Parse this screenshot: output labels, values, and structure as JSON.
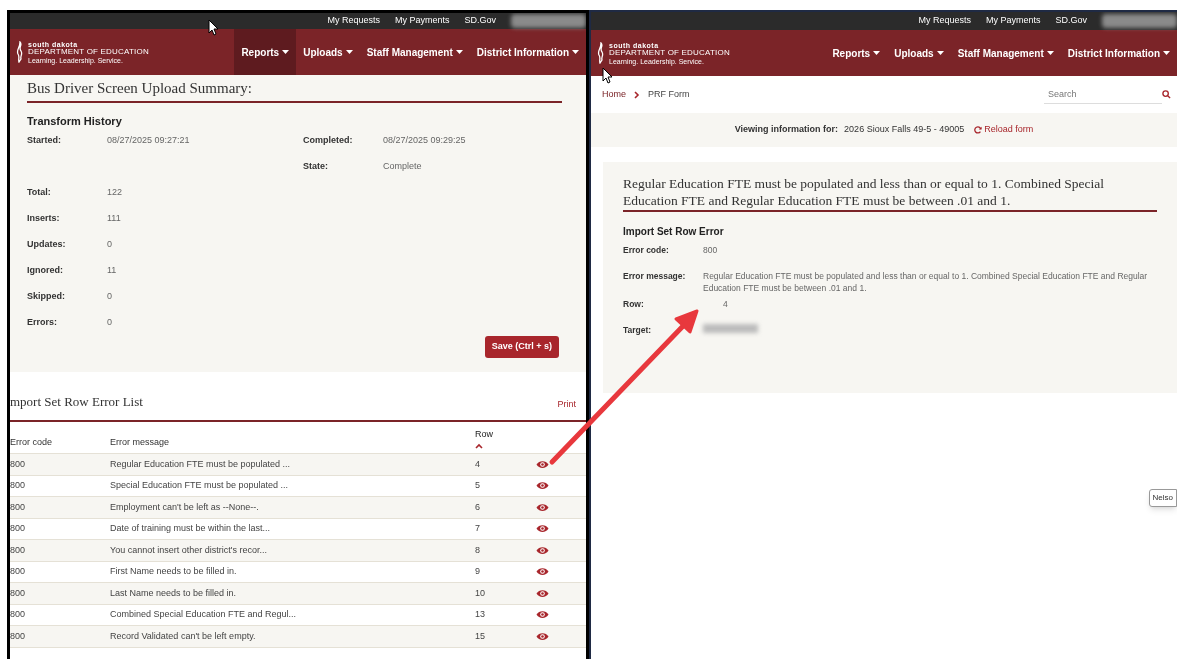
{
  "left": {
    "top_links": [
      "My Requests",
      "My Payments",
      "SD.Gov"
    ],
    "logo": {
      "line1": "south dakota",
      "line2": "DEPARTMENT OF EDUCATION",
      "tagline": "Learning. Leadership. Service."
    },
    "nav": [
      {
        "label": "Reports",
        "selected": true
      },
      {
        "label": "Uploads",
        "selected": false
      },
      {
        "label": "Staff Management",
        "selected": false
      },
      {
        "label": "District Information",
        "selected": false
      }
    ],
    "title": "Bus Driver Screen Upload Summary:",
    "history": {
      "title": "Transform History",
      "column_1": [
        {
          "label": "Started:",
          "value": "08/27/2025 09:27:21"
        }
      ],
      "column_2": [
        {
          "label": "Completed:",
          "value": "08/27/2025 09:29:25"
        },
        {
          "label": "State:",
          "value": "Complete"
        }
      ],
      "counts": [
        {
          "label": "Total:",
          "value": "122"
        },
        {
          "label": "Inserts:",
          "value": "111"
        },
        {
          "label": "Updates:",
          "value": "0"
        },
        {
          "label": "Ignored:",
          "value": "11"
        },
        {
          "label": "Skipped:",
          "value": "0"
        },
        {
          "label": "Errors:",
          "value": "0"
        }
      ]
    },
    "save_button": "Save (Ctrl + s)",
    "error_list": {
      "title": "mport Set Row Error List",
      "print_link": "Print",
      "columns": [
        {
          "label": "Error code",
          "sorted": false
        },
        {
          "label": "Error message",
          "sorted": false
        },
        {
          "label": "Row",
          "sorted": true
        }
      ],
      "rows": [
        {
          "code": "800",
          "message": "Regular Education FTE must be populated ...",
          "row": "4"
        },
        {
          "code": "800",
          "message": "Special Education FTE must be populated ...",
          "row": "5"
        },
        {
          "code": "800",
          "message": "Employment can't be left as --None--.",
          "row": "6"
        },
        {
          "code": "800",
          "message": "Date of training must be within the last...",
          "row": "7"
        },
        {
          "code": "800",
          "message": "You cannot insert other district's recor...",
          "row": "8"
        },
        {
          "code": "800",
          "message": "First Name needs to be filled in.",
          "row": "9"
        },
        {
          "code": "800",
          "message": "Last Name needs to be filled in.",
          "row": "10"
        },
        {
          "code": "800",
          "message": "Combined Special Education FTE and Regul...",
          "row": "13"
        },
        {
          "code": "800",
          "message": "Record Validated can't be left empty.",
          "row": "15"
        }
      ]
    }
  },
  "right": {
    "top_links": [
      "My Requests",
      "My Payments",
      "SD.Gov"
    ],
    "logo": {
      "line1": "south dakota",
      "line2": "DEPARTMENT OF EDUCATION",
      "tagline": "Learning. Leadership. Service."
    },
    "nav": [
      {
        "label": "Reports",
        "selected": false
      },
      {
        "label": "Uploads",
        "selected": false
      },
      {
        "label": "Staff Management",
        "selected": false
      },
      {
        "label": "District Information",
        "selected": false
      }
    ],
    "breadcrumb": [
      "Home",
      "PRF Form"
    ],
    "search": {
      "placeholder": "Search"
    },
    "viewing": {
      "label": "Viewing information for:",
      "value": "2026 Sioux Falls 49-5 - 49005",
      "reload_link": "Reload form"
    },
    "error_detail": {
      "heading": "Regular Education FTE must be populated and less than or equal to 1. Combined Special Education FTE and Regular Education FTE must be between .01 and 1.",
      "section_title": "Import Set Row Error",
      "fields": [
        {
          "label": "Error code:",
          "value": "800"
        },
        {
          "label": "Error message:",
          "value": "Regular Education FTE must be populated and less than or equal to 1. Combined Special Education FTE and Regular Education FTE must be between .01 and 1."
        },
        {
          "label": "Row:",
          "value": "4"
        },
        {
          "label": "Target:"
        }
      ]
    },
    "tooltip": "Nelso"
  }
}
